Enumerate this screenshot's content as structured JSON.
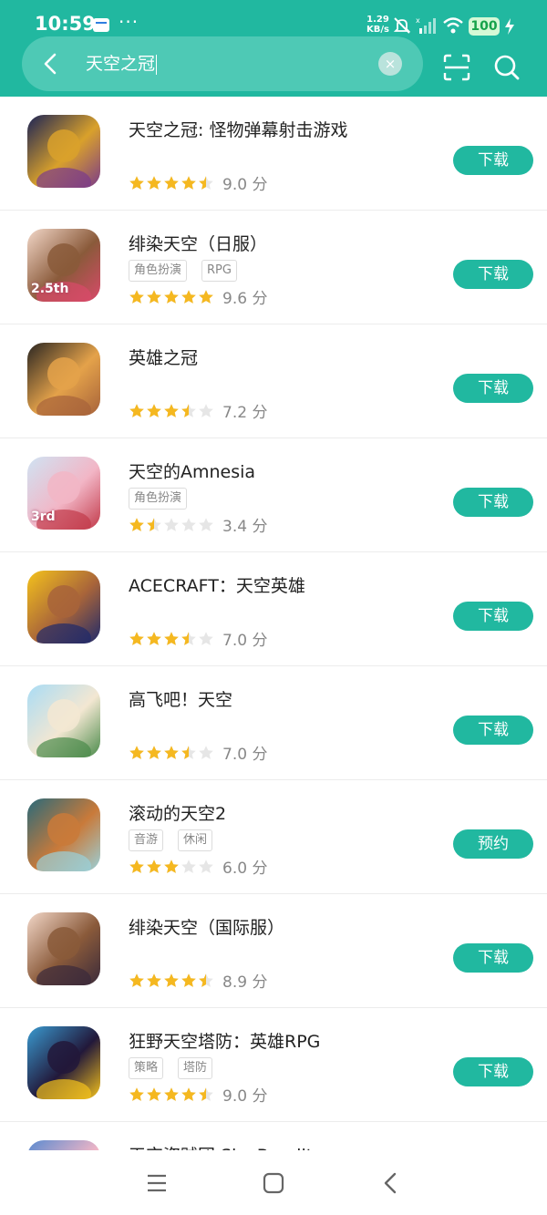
{
  "status_bar": {
    "time": "10:59",
    "notification_icons": [
      "mail-icon",
      "more-dots-icon"
    ],
    "more_dots": "···",
    "net_speed_value": "1.29",
    "net_speed_unit": "KB/s",
    "battery": "100"
  },
  "search": {
    "query": "天空之冠",
    "clear_icon": "×"
  },
  "results": [
    {
      "title": "天空之冠: 怪物弹幕射击游戏",
      "tags": [],
      "rating": 4.5,
      "score": "9.0 分",
      "action": "下载",
      "icon_colors": [
        "#1b2356",
        "#d9a12b",
        "#7a3a8a"
      ]
    },
    {
      "title": "绯染天空（日服）",
      "tags": [
        "角色扮演",
        "RPG"
      ],
      "rating": 5,
      "score": "9.6 分",
      "action": "下载",
      "icon_colors": [
        "#f2d7c8",
        "#8a5a3a",
        "#d94a6a"
      ],
      "icon_badge": "2.5th"
    },
    {
      "title": "英雄之冠",
      "tags": [],
      "rating": 3.5,
      "score": "7.2 分",
      "action": "下载",
      "icon_colors": [
        "#2a2622",
        "#e4a24a",
        "#a6623a"
      ]
    },
    {
      "title": "天空的Amnesia",
      "tags": [
        "角色扮演"
      ],
      "rating": 1.5,
      "score": "3.4 分",
      "action": "下载",
      "icon_colors": [
        "#cfe3f3",
        "#f2b6c6",
        "#c23a4a"
      ],
      "icon_badge": "3rd"
    },
    {
      "title": "ACECRAFT：天空英雄",
      "tags": [],
      "rating": 3.5,
      "score": "7.0 分",
      "action": "下载",
      "icon_colors": [
        "#f4c21c",
        "#a8643a",
        "#1f2a6a"
      ]
    },
    {
      "title": "高飞吧！天空",
      "tags": [],
      "rating": 3.5,
      "score": "7.0 分",
      "action": "下载",
      "icon_colors": [
        "#a9dcf5",
        "#f3e7d2",
        "#4a8a4a"
      ]
    },
    {
      "title": "滚动的天空2",
      "tags": [
        "音游",
        "休闲"
      ],
      "rating": 3,
      "score": "6.0 分",
      "action": "预约",
      "icon_colors": [
        "#2a6a7a",
        "#c97a3a",
        "#9ad0d8"
      ]
    },
    {
      "title": "绯染天空（国际服）",
      "tags": [],
      "rating": 4.5,
      "score": "8.9 分",
      "action": "下载",
      "icon_colors": [
        "#f2d7c8",
        "#8a5a3a",
        "#3a2a3a"
      ]
    },
    {
      "title": "狂野天空塔防：英雄RPG",
      "tags": [
        "策略",
        "塔防"
      ],
      "rating": 4.5,
      "score": "9.0 分",
      "action": "下载",
      "icon_colors": [
        "#3a9ad0",
        "#22183a",
        "#f4c21c"
      ]
    },
    {
      "title": "天空盗贼团 Sky Bandit",
      "tags": [],
      "rating": 0,
      "score": "",
      "action": "",
      "icon_colors": [
        "#5a8ad0",
        "#f2b6c6",
        "#7a5ad0"
      ]
    }
  ],
  "colors": {
    "accent": "#21b8a0",
    "star_filled": "#f5b820",
    "star_empty": "#e6e6e6"
  }
}
